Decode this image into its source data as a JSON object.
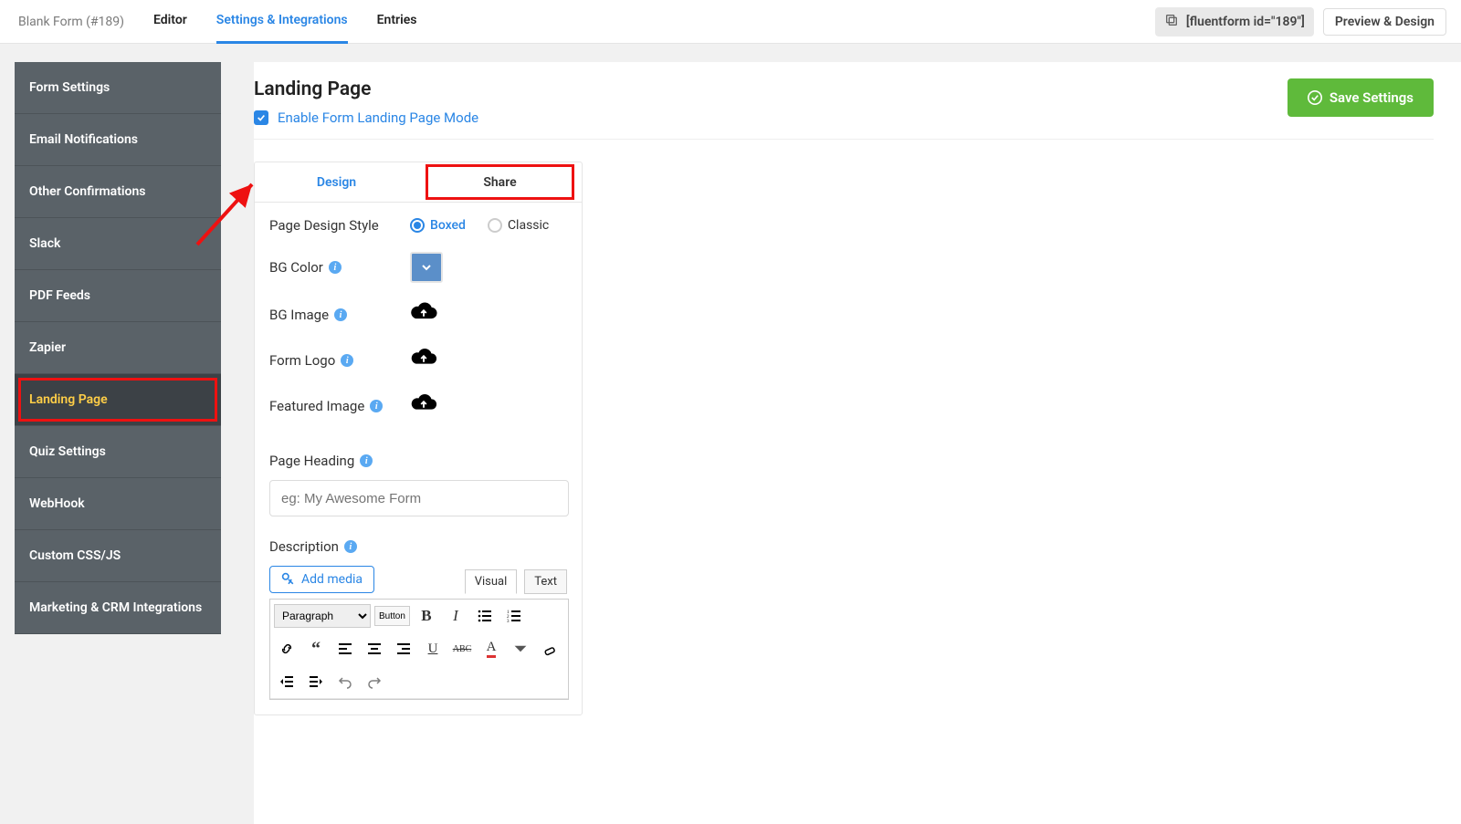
{
  "topnav": {
    "form_name": "Blank Form (#189)",
    "tabs": {
      "editor": "Editor",
      "settings": "Settings & Integrations",
      "entries": "Entries"
    },
    "shortcode": "[fluentform id=\"189\"]",
    "preview": "Preview & Design"
  },
  "sidebar": {
    "items": [
      "Form Settings",
      "Email Notifications",
      "Other Confirmations",
      "Slack",
      "PDF Feeds",
      "Zapier",
      "Landing Page",
      "Quiz Settings",
      "WebHook",
      "Custom CSS/JS",
      "Marketing & CRM Integrations"
    ]
  },
  "main": {
    "title": "Landing Page",
    "enable_label": "Enable Form Landing Page Mode",
    "save": "Save Settings",
    "design_tabs": {
      "design": "Design",
      "share": "Share"
    },
    "fields": {
      "page_design_style": "Page Design Style",
      "boxed": "Boxed",
      "classic": "Classic",
      "bg_color": "BG Color",
      "bg_image": "BG Image",
      "form_logo": "Form Logo",
      "featured_image": "Featured Image",
      "page_heading": "Page Heading",
      "heading_placeholder": "eg: My Awesome Form",
      "description": "Description",
      "add_media": "Add media",
      "ed_visual": "Visual",
      "ed_text": "Text",
      "tb_paragraph": "Paragraph",
      "tb_button": "Button"
    }
  }
}
